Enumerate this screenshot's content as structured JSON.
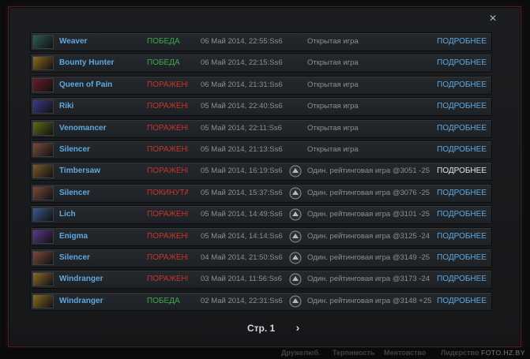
{
  "window": {
    "close_label": "×"
  },
  "matches": [
    {
      "hero": "Weaver",
      "result": "ПОБЕДА",
      "result_type": "win",
      "date": "06 Май 2014, 22:55:Ss6",
      "mode": "Открытая игра",
      "ranked": false,
      "details": "ПОДРОБНЕЕ",
      "avatar_color": "#2f5b55"
    },
    {
      "hero": "Bounty Hunter",
      "result": "ПОБЕДА",
      "result_type": "win",
      "date": "06 Май 2014, 22:15:Ss6",
      "mode": "Открытая игра",
      "ranked": false,
      "details": "ПОДРОБНЕЕ",
      "avatar_color": "#8a6a22"
    },
    {
      "hero": "Queen of Pain",
      "result": "ПОРАЖЕНИ",
      "result_type": "loss",
      "date": "06 Май 2014, 21:31:Ss6",
      "mode": "Открытая игра",
      "ranked": false,
      "details": "ПОДРОБНЕЕ",
      "avatar_color": "#6a1b2a"
    },
    {
      "hero": "Riki",
      "result": "ПОРАЖЕНИ",
      "result_type": "loss",
      "date": "05 Май 2014, 22:40:Ss6",
      "mode": "Открытая игра",
      "ranked": false,
      "details": "ПОДРОБНЕЕ",
      "avatar_color": "#3a3a8a"
    },
    {
      "hero": "Venomancer",
      "result": "ПОРАЖЕНИ",
      "result_type": "loss",
      "date": "05 Май 2014, 22:11:Ss6",
      "mode": "Открытая игра",
      "ranked": false,
      "details": "ПОДРОБНЕЕ",
      "avatar_color": "#5f6a1a"
    },
    {
      "hero": "Silencer",
      "result": "ПОРАЖЕНИ",
      "result_type": "loss",
      "date": "05 Май 2014, 21:13:Ss6",
      "mode": "Открытая игра",
      "ranked": false,
      "details": "ПОДРОБНЕЕ",
      "avatar_color": "#7a4a3a"
    },
    {
      "hero": "Timbersaw",
      "result": "ПОРАЖЕНИ",
      "result_type": "loss",
      "date": "05 Май 2014, 16:19:Ss6",
      "mode": "Один. рейтинговая игра @3051 -25",
      "ranked": true,
      "details": "ПОДРОБНЕЕ",
      "details_active": true,
      "avatar_color": "#7a5a2a"
    },
    {
      "hero": "Silencer",
      "result": "ПОКИНУТА",
      "result_type": "loss",
      "date": "05 Май 2014, 15:37:Ss6",
      "mode": "Один. рейтинговая игра @3076 -25",
      "ranked": true,
      "details": "ПОДРОБНЕЕ",
      "avatar_color": "#7a4a3a"
    },
    {
      "hero": "Lich",
      "result": "ПОРАЖЕНИ",
      "result_type": "loss",
      "date": "05 Май 2014, 14:49:Ss6",
      "mode": "Один. рейтинговая игра @3101 -25",
      "ranked": true,
      "details": "ПОДРОБНЕЕ",
      "avatar_color": "#3a5a8a"
    },
    {
      "hero": "Enigma",
      "result": "ПОРАЖЕНИ",
      "result_type": "loss",
      "date": "05 Май 2014, 14:14:Ss6",
      "mode": "Один. рейтинговая игра @3125 -24",
      "ranked": true,
      "details": "ПОДРОБНЕЕ",
      "avatar_color": "#5a3a8a"
    },
    {
      "hero": "Silencer",
      "result": "ПОРАЖЕНИ",
      "result_type": "loss",
      "date": "04 Май 2014, 21:50:Ss6",
      "mode": "Один. рейтинговая игра @3149 -25",
      "ranked": true,
      "details": "ПОДРОБНЕЕ",
      "avatar_color": "#7a4a3a"
    },
    {
      "hero": "Windranger",
      "result": "ПОРАЖЕНИ",
      "result_type": "loss",
      "date": "03 Май 2014, 11:56:Ss6",
      "mode": "Один. рейтинговая игра @3173 -24",
      "ranked": true,
      "details": "ПОДРОБНЕЕ",
      "avatar_color": "#8a6a2a"
    },
    {
      "hero": "Windranger",
      "result": "ПОБЕДА",
      "result_type": "win",
      "date": "02 Май 2014, 22:31:Ss6",
      "mode": "Один. рейтинговая игра @3148 +25",
      "ranked": true,
      "details": "ПОДРОБНЕЕ",
      "avatar_color": "#8a6a2a"
    }
  ],
  "pager": {
    "label": "Стр. 1",
    "next_label": "›"
  },
  "bottom_tabs": [
    "Дружелюб.",
    "Терпимость",
    "Ментовство",
    "Лидерство"
  ],
  "watermark": "FOTO.HZ.BY",
  "colors": {
    "win": "#3ea84a",
    "loss": "#c6352f",
    "link": "#5fa9e0"
  }
}
